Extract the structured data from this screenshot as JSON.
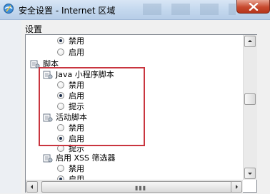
{
  "window": {
    "title": "安全设置 - Internet 区域"
  },
  "settings_label": "设置",
  "rows": [
    {
      "kind": "radio",
      "label": "禁用",
      "checked": true
    },
    {
      "kind": "radio",
      "label": "启用",
      "checked": false
    },
    {
      "kind": "category",
      "label": "脚本"
    },
    {
      "kind": "setting",
      "label": "Java 小程序脚本"
    },
    {
      "kind": "radio",
      "label": "禁用",
      "checked": false
    },
    {
      "kind": "radio",
      "label": "启用",
      "checked": true
    },
    {
      "kind": "radio",
      "label": "提示",
      "checked": false
    },
    {
      "kind": "setting",
      "label": "活动脚本"
    },
    {
      "kind": "radio",
      "label": "禁用",
      "checked": false
    },
    {
      "kind": "radio",
      "label": "启用",
      "checked": true
    },
    {
      "kind": "radio",
      "label": "提示",
      "checked": false
    },
    {
      "kind": "setting",
      "label": "启用 XSS 筛选器"
    },
    {
      "kind": "radio",
      "label": "禁用",
      "checked": false
    },
    {
      "kind": "radio",
      "label": "启用",
      "checked": true
    }
  ],
  "icons": {
    "window": "ie-security-icon",
    "close": "close-icon",
    "setting": "settings-gear-icon"
  }
}
